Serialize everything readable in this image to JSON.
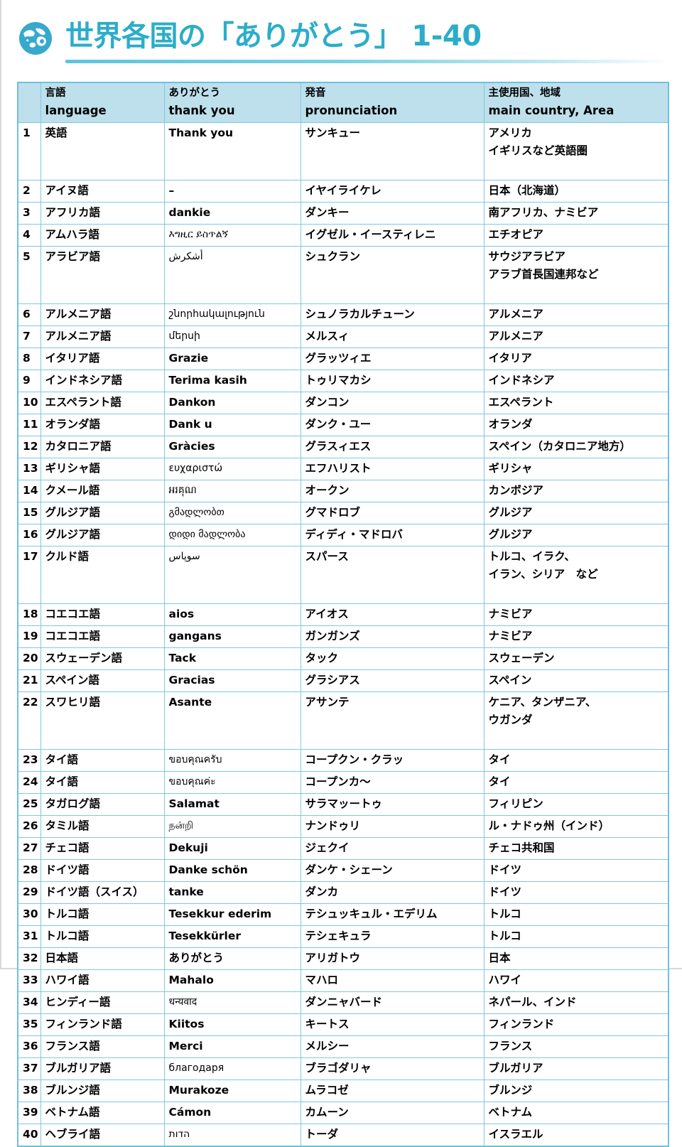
{
  "title": {
    "text": "世界各国の「ありがとう」 1-40",
    "icon": "globe-icon",
    "color": "#2badc9",
    "underline_color": "#5cc5dd"
  },
  "table": {
    "header_bg": "#bde0ec",
    "border_color": "#7ec8e3",
    "columns": [
      {
        "key": "num",
        "ja": "",
        "en": ""
      },
      {
        "key": "lang",
        "ja": "言語",
        "en": "language"
      },
      {
        "key": "thank",
        "ja": "ありがとう",
        "en": "thank you"
      },
      {
        "key": "pron",
        "ja": "発音",
        "en": "pronunciation"
      },
      {
        "key": "area",
        "ja": "主使用国、地域",
        "en": "main country, Area"
      }
    ],
    "rows": [
      {
        "num": "1",
        "lang": "英語",
        "thank": "Thank you",
        "script": false,
        "pron": "サンキュー",
        "area": [
          "アメリカ",
          "イギリスなど英語圏"
        ]
      },
      {
        "num": "2",
        "lang": "アイヌ語",
        "thank": "–",
        "script": false,
        "pron": "イヤイライケレ",
        "area": [
          "日本（北海道）"
        ]
      },
      {
        "num": "3",
        "lang": "アフリカ語",
        "thank": "dankie",
        "script": false,
        "pron": "ダンキー",
        "area": [
          "南アフリカ、ナミビア"
        ]
      },
      {
        "num": "4",
        "lang": "アムハラ語",
        "thank": "እግዚር ይስጥልኝ",
        "script": true,
        "pron": "イグゼル・イースティレニ",
        "area": [
          "エチオピア"
        ]
      },
      {
        "num": "5",
        "lang": "アラビア語",
        "thank": "أشكرش",
        "script": true,
        "pron": "シュクラン",
        "area": [
          "サウジアラビア",
          "アラブ首長国連邦など"
        ]
      },
      {
        "num": "6",
        "lang": "アルメニア語",
        "thank": "շնորհակալություն",
        "script": true,
        "pron": "シュノラカルチューン",
        "area": [
          "アルメニア"
        ]
      },
      {
        "num": "7",
        "lang": "アルメニア語",
        "thank": "մերսի",
        "script": true,
        "pron": "メルスィ",
        "area": [
          "アルメニア"
        ]
      },
      {
        "num": "8",
        "lang": "イタリア語",
        "thank": "Grazie",
        "script": false,
        "pron": "グラッツィエ",
        "area": [
          "イタリア"
        ]
      },
      {
        "num": "9",
        "lang": "インドネシア語",
        "thank": "Terima kasih",
        "script": false,
        "pron": "トゥリマカシ",
        "area": [
          "インドネシア"
        ]
      },
      {
        "num": "10",
        "lang": "エスペラント語",
        "thank": "Dankon",
        "script": false,
        "pron": "ダンコン",
        "area": [
          "エスペラント"
        ]
      },
      {
        "num": "11",
        "lang": "オランダ語",
        "thank": "Dank u",
        "script": false,
        "pron": "ダンク・ユー",
        "area": [
          "オランダ"
        ]
      },
      {
        "num": "12",
        "lang": "カタロニア語",
        "thank": "Gràcies",
        "script": false,
        "pron": "グラスィエス",
        "area": [
          "スペイン（カタロニア地方）"
        ]
      },
      {
        "num": "13",
        "lang": "ギリシャ語",
        "thank": "ευχαριστώ",
        "script": true,
        "pron": "エフハリスト",
        "area": [
          "ギリシャ"
        ]
      },
      {
        "num": "14",
        "lang": "クメール語",
        "thank": "អរគុណ",
        "script": true,
        "pron": "オークン",
        "area": [
          "カンボジア"
        ]
      },
      {
        "num": "15",
        "lang": "グルジア語",
        "thank": "გმადლობთ",
        "script": true,
        "pron": "グマドロブ",
        "area": [
          "グルジア"
        ]
      },
      {
        "num": "16",
        "lang": "グルジア語",
        "thank": "დიდი მადლობა",
        "script": true,
        "pron": "ディディ・マドロバ",
        "area": [
          "グルジア"
        ]
      },
      {
        "num": "17",
        "lang": "クルド語",
        "thank": "سوپاس",
        "script": true,
        "pron": "スパース",
        "area": [
          "トルコ、イラク、",
          "イラン、シリア　など"
        ]
      },
      {
        "num": "18",
        "lang": "コエコエ語",
        "thank": "aios",
        "script": false,
        "pron": "アイオス",
        "area": [
          "ナミビア"
        ]
      },
      {
        "num": "19",
        "lang": "コエコエ語",
        "thank": "gangans",
        "script": false,
        "pron": "ガンガンズ",
        "area": [
          "ナミビア"
        ]
      },
      {
        "num": "20",
        "lang": "スウェーデン語",
        "thank": "Tack",
        "script": false,
        "pron": "タック",
        "area": [
          "スウェーデン"
        ]
      },
      {
        "num": "21",
        "lang": "スペイン語",
        "thank": "Gracias",
        "script": false,
        "pron": "グラシアス",
        "area": [
          "スペイン"
        ]
      },
      {
        "num": "22",
        "lang": "スワヒリ語",
        "thank": "Asante",
        "script": false,
        "pron": "アサンテ",
        "area": [
          "ケニア、タンザニア、",
          "ウガンダ"
        ]
      },
      {
        "num": "23",
        "lang": "タイ語",
        "thank": "ขอบคุณครับ",
        "script": true,
        "pron": "コープクン・クラッ",
        "area": [
          "タイ"
        ]
      },
      {
        "num": "24",
        "lang": "タイ語",
        "thank": "ขอบคุณค่ะ",
        "script": true,
        "pron": "コープンカ〜",
        "area": [
          "タイ"
        ]
      },
      {
        "num": "25",
        "lang": "タガログ語",
        "thank": "Salamat",
        "script": false,
        "pron": "サラマッートゥ",
        "area": [
          "フィリピン"
        ]
      },
      {
        "num": "26",
        "lang": "タミル語",
        "thank": "நன்றி",
        "script": true,
        "pron": "ナンドゥリ",
        "area": [
          "ル・ナドゥ州（インド）"
        ]
      },
      {
        "num": "27",
        "lang": "チェコ語",
        "thank": "Dekuji",
        "script": false,
        "pron": "ジェクイ",
        "area": [
          "チェコ共和国"
        ]
      },
      {
        "num": "28",
        "lang": "ドイツ語",
        "thank": "Danke schön",
        "script": false,
        "pron": "ダンケ・シェーン",
        "area": [
          "ドイツ"
        ]
      },
      {
        "num": "29",
        "lang": "ドイツ語（スイス）",
        "thank": "tanke",
        "script": false,
        "pron": "ダンカ",
        "area": [
          "ドイツ"
        ]
      },
      {
        "num": "30",
        "lang": "トルコ語",
        "thank": "Tesekkur ederim",
        "script": false,
        "pron": "テシュッキュル・エデリム",
        "area": [
          "トルコ"
        ]
      },
      {
        "num": "31",
        "lang": "トルコ語",
        "thank": "Tesekkürler",
        "script": false,
        "pron": "テシェキュラ",
        "area": [
          "トルコ"
        ]
      },
      {
        "num": "32",
        "lang": "日本語",
        "thank": "ありがとう",
        "script": false,
        "pron": "アリガトウ",
        "area": [
          "日本"
        ]
      },
      {
        "num": "33",
        "lang": "ハワイ語",
        "thank": "Mahalo",
        "script": false,
        "pron": "マハロ",
        "area": [
          "ハワイ"
        ]
      },
      {
        "num": "34",
        "lang": "ヒンディー語",
        "thank": "धन्यवाद",
        "script": true,
        "pron": "ダンニャバード",
        "area": [
          "ネパール、インド"
        ]
      },
      {
        "num": "35",
        "lang": "フィンランド語",
        "thank": "Kiitos",
        "script": false,
        "pron": "キートス",
        "area": [
          "フィンランド"
        ]
      },
      {
        "num": "36",
        "lang": "フランス語",
        "thank": "Merci",
        "script": false,
        "pron": "メルシー",
        "area": [
          "フランス"
        ]
      },
      {
        "num": "37",
        "lang": "ブルガリア語",
        "thank": "благодаря",
        "script": true,
        "pron": "ブラゴダリャ",
        "area": [
          "ブルガリア"
        ]
      },
      {
        "num": "38",
        "lang": "ブルンジ語",
        "thank": "Murakoze",
        "script": false,
        "pron": "ムラコゼ",
        "area": [
          "ブルンジ"
        ]
      },
      {
        "num": "39",
        "lang": "ベトナム語",
        "thank": "Cámon",
        "script": false,
        "pron": "カムーン",
        "area": [
          "ベトナム"
        ]
      },
      {
        "num": "40",
        "lang": "ヘブライ語",
        "thank": "הדות",
        "script": true,
        "pron": "トーダ",
        "area": [
          "イスラエル"
        ]
      }
    ]
  }
}
